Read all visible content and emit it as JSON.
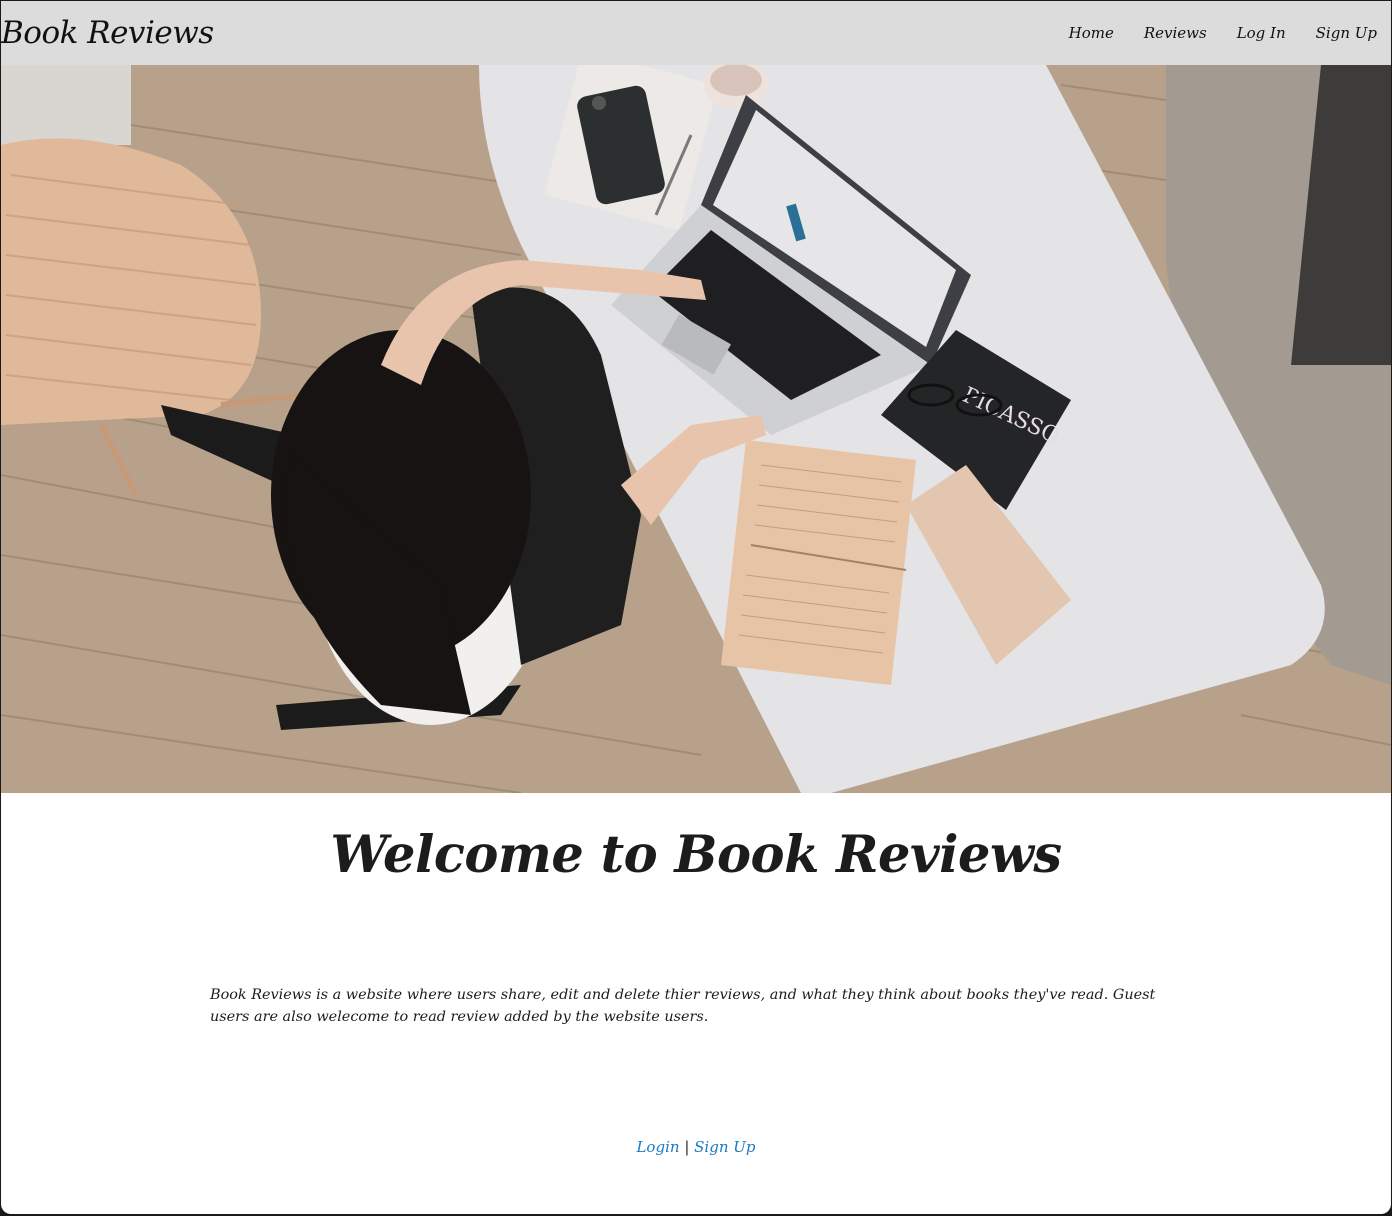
{
  "navbar": {
    "brand": "Book Reviews",
    "links": [
      {
        "label": "Home"
      },
      {
        "label": "Reviews"
      },
      {
        "label": "Log In"
      },
      {
        "label": "Sign Up"
      }
    ]
  },
  "hero": {
    "image_subject": "Overhead photo of a woman typing on a laptop at a white table with open books, a phone, notebook, glasses and a coffee mug on a wooden floor",
    "book_cover_text": "PICASSO"
  },
  "main": {
    "title": "Welcome to Book Reviews",
    "intro": "Book Reviews is a website where users share, edit and delete thier reviews, and what they think about books they've read. Guest users are also welecome to read review added by the website users.",
    "cta": {
      "login_label": "Login",
      "separator": "|",
      "signup_label": "Sign Up"
    }
  },
  "colors": {
    "navbar_bg": "#dcdcdc",
    "link_blue": "#1a7ac4",
    "text_dark": "#1c1c1c"
  }
}
